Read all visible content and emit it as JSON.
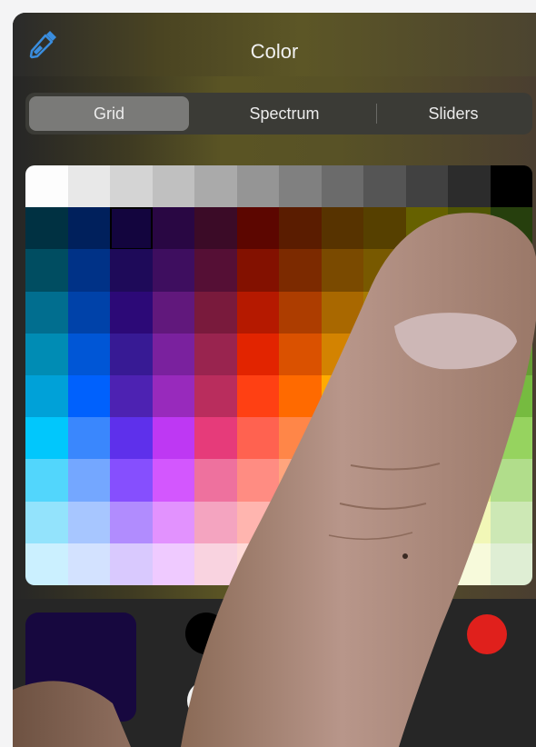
{
  "header": {
    "title": "Color",
    "eyedropper_icon": "eyedropper-icon"
  },
  "tabs": [
    {
      "label": "Grid",
      "active": true
    },
    {
      "label": "Spectrum",
      "active": false
    },
    {
      "label": "Sliders",
      "active": false
    }
  ],
  "grid": {
    "columns": 12,
    "selected": {
      "row": 1,
      "col": 2
    },
    "rows": [
      [
        "#fdfdfd",
        "#e8e8e8",
        "#d4d4d4",
        "#c0c0c0",
        "#aaaaaa",
        "#959595",
        "#808080",
        "#6b6b6b",
        "#555555",
        "#414141",
        "#2c2c2c",
        "#000000"
      ],
      [
        "#003142",
        "#00205c",
        "#13053e",
        "#290743",
        "#3b0b27",
        "#5c0600",
        "#5a1c00",
        "#573300",
        "#564000",
        "#666100",
        "#4f5504",
        "#263f0d"
      ],
      [
        "#004d61",
        "#003287",
        "#1e0a59",
        "#3e0e5f",
        "#550f35",
        "#831100",
        "#7c2a00",
        "#7a4a00",
        "#785900",
        "#8c8700",
        "#6e7607",
        "#385719"
      ],
      [
        "#016e8f",
        "#0042a9",
        "#2c0977",
        "#61187c",
        "#791a3c",
        "#b51900",
        "#ad3d00",
        "#a96800",
        "#a67b01",
        "#c4bc00",
        "#9ba50e",
        "#4e7a27"
      ],
      [
        "#008cb4",
        "#0056d6",
        "#371a94",
        "#7a219e",
        "#99244f",
        "#e22400",
        "#da5100",
        "#d38301",
        "#d19d01",
        "#f5ec00",
        "#c3d117",
        "#669d34"
      ],
      [
        "#00a1d8",
        "#0061fd",
        "#4d22b2",
        "#982abc",
        "#b92d5d",
        "#ff4013",
        "#ff6a00",
        "#ffab01",
        "#fcc700",
        "#fefb41",
        "#d9ec37",
        "#76bb40"
      ],
      [
        "#01c7fc",
        "#3a87fd",
        "#5e30eb",
        "#be38f3",
        "#e63b7a",
        "#ff6250",
        "#ff8648",
        "#feb43f",
        "#fecb3e",
        "#fff76b",
        "#e4ef65",
        "#96d35f"
      ],
      [
        "#52d6fc",
        "#74a7ff",
        "#864ffe",
        "#d357fe",
        "#ee719e",
        "#ff8c82",
        "#ffa57d",
        "#ffc777",
        "#ffd977",
        "#fff994",
        "#eaf28f",
        "#b1dd8b"
      ],
      [
        "#93e3fc",
        "#a7c6ff",
        "#b18cfe",
        "#e292fe",
        "#f4a4c0",
        "#ffb5af",
        "#ffc5ab",
        "#ffd9a8",
        "#fee4a8",
        "#fffbb9",
        "#f2f7b7",
        "#cde8b5"
      ],
      [
        "#cbf0ff",
        "#d3e2ff",
        "#d9c9fe",
        "#efcaff",
        "#f9d3e0",
        "#ffdbd8",
        "#ffe2d6",
        "#ffecd4",
        "#fff2d5",
        "#fefcdd",
        "#f7fadb",
        "#dfeed4"
      ]
    ]
  },
  "current_color": "#17083f",
  "favorites": [
    {
      "name": "black-swatch",
      "color": "#000000"
    },
    {
      "name": "white-swatch",
      "color": "#f1f1f1"
    },
    {
      "name": "red-swatch",
      "color": "#e0201c"
    }
  ]
}
